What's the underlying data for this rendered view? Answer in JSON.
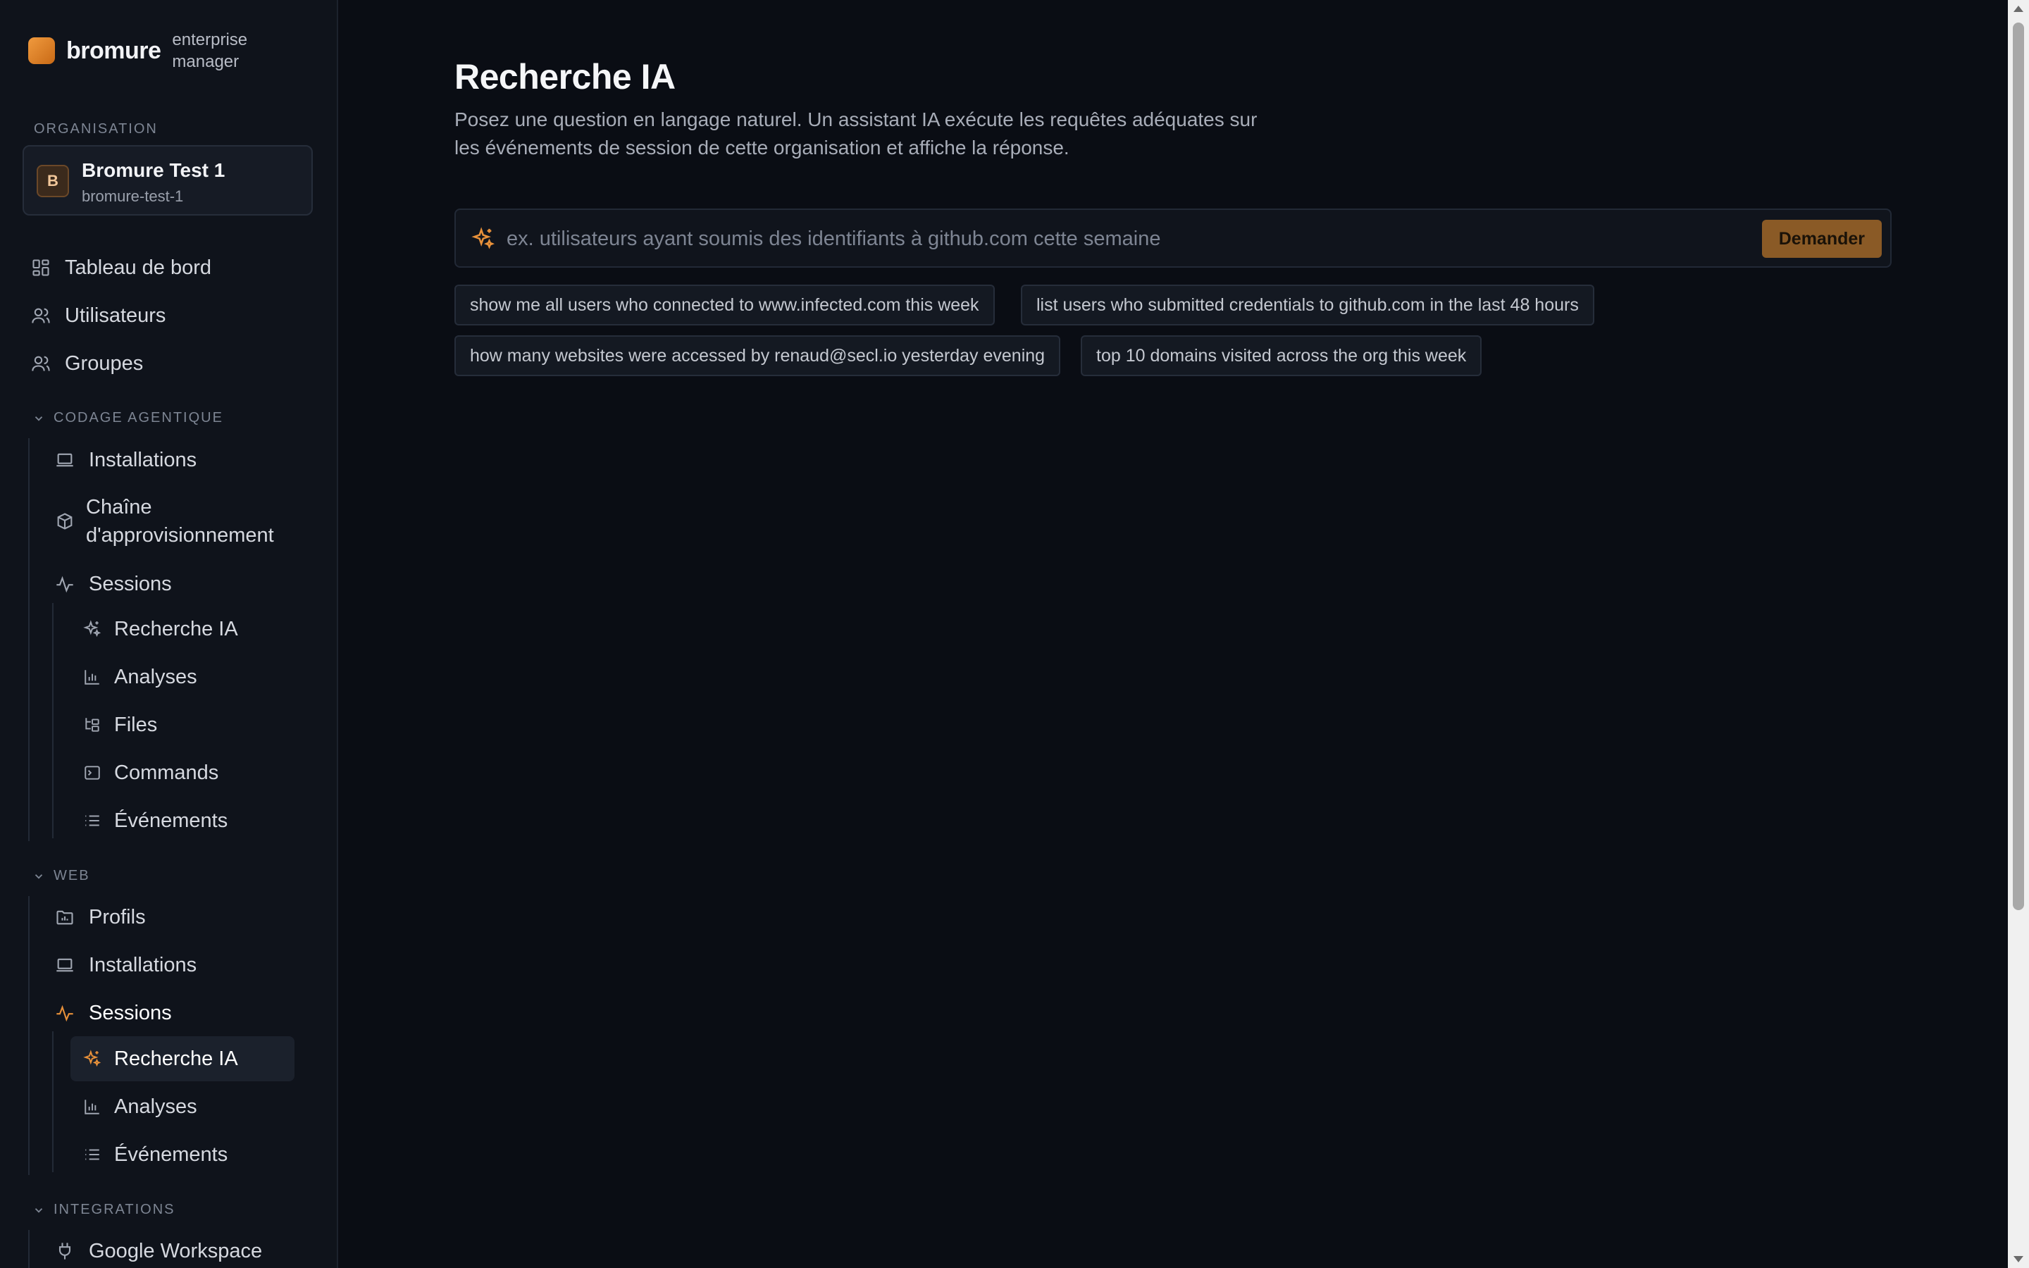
{
  "brand": {
    "name": "bromure",
    "subtitle": "enterprise manager",
    "logo_color": "#e8913a"
  },
  "organization": {
    "section_label": "ORGANISATION",
    "avatar_letter": "B",
    "name": "Bromure Test 1",
    "slug": "bromure-test-1"
  },
  "nav": {
    "dashboard": "Tableau de bord",
    "users": "Utilisateurs",
    "groups": "Groupes"
  },
  "agentic": {
    "section_label": "CODAGE AGENTIQUE",
    "installations": "Installations",
    "supply_chain_line1": "Chaîne",
    "supply_chain_line2": "d'approvisionnement",
    "sessions": "Sessions",
    "ai_search": "Recherche IA",
    "analytics": "Analyses",
    "files": "Files",
    "commands": "Commands",
    "events": "Événements"
  },
  "web": {
    "section_label": "WEB",
    "profiles": "Profils",
    "installations": "Installations",
    "sessions": "Sessions",
    "ai_search": "Recherche IA",
    "analytics": "Analyses",
    "events": "Événements"
  },
  "integrations": {
    "section_label": "INTEGRATIONS",
    "google_workspace": "Google Workspace"
  },
  "main": {
    "title": "Recherche IA",
    "description": "Posez une question en langage naturel. Un assistant IA exécute les requêtes adéquates sur les événements de session de cette organisation et affiche la réponse.",
    "search_placeholder": "ex. utilisateurs ayant soumis des identifiants à github.com cette semaine",
    "search_value": "",
    "ask_label": "Demander",
    "suggestions": [
      "show me all users who connected to www.infected.com this week",
      "list users who submitted credentials to github.com in the last 48 hours",
      "how many websites were accessed by renaud@secl.io yesterday evening",
      "top 10 domains visited across the org this week"
    ]
  },
  "colors": {
    "accent": "#e8913a",
    "background": "#0a0d14",
    "sidebar": "#0f131b"
  }
}
